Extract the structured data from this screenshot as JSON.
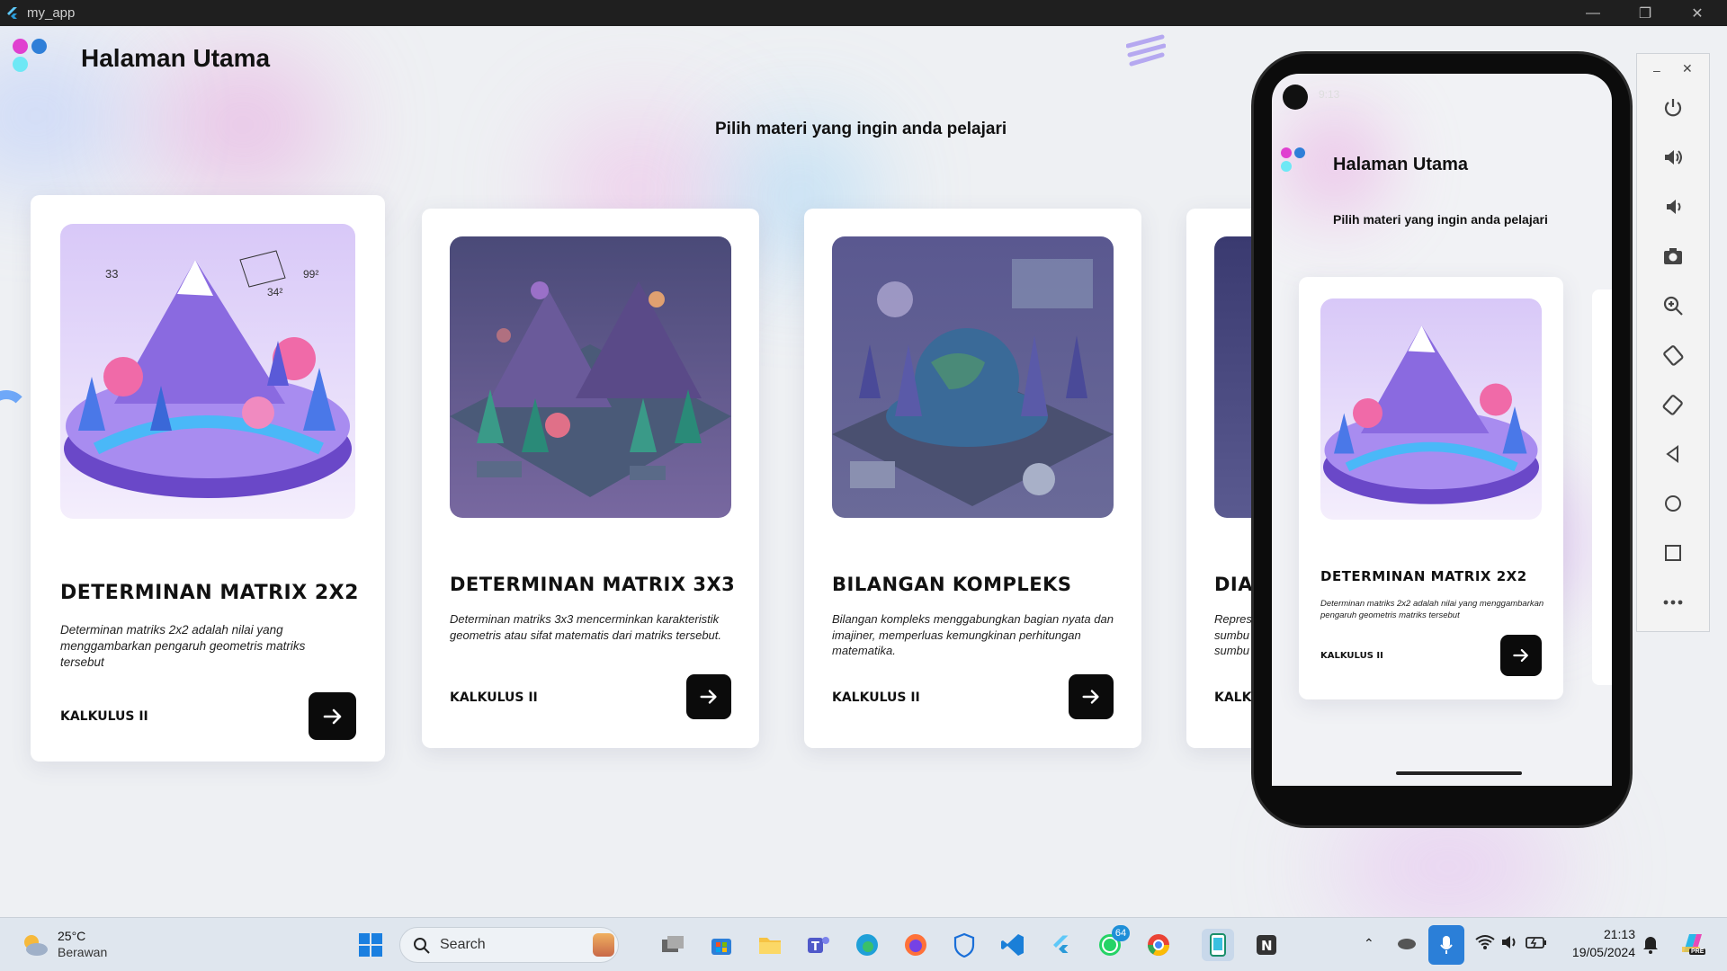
{
  "window": {
    "title": "my_app"
  },
  "page": {
    "title": "Halaman Utama",
    "subtitle": "Pilih materi yang ingin anda pelajari"
  },
  "cards": [
    {
      "title": "DETERMINAN MATRIX 2X2",
      "desc": "Determinan matriks 2x2 adalah nilai yang menggambarkan pengaruh geometris matriks tersebut",
      "tag": "KALKULUS II"
    },
    {
      "title": "DETERMINAN MATRIX 3X3",
      "desc": "Determinan matriks 3x3 mencerminkan karakteristik geometris atau sifat matematis dari matriks tersebut.",
      "tag": "KALKULUS II"
    },
    {
      "title": "BILANGAN KOMPLEKS",
      "desc": "Bilangan kompleks menggabungkan bagian nyata dan imajiner, memperluas kemungkinan perhitungan matematika.",
      "tag": "KALKULUS II"
    },
    {
      "title": "DIA",
      "desc_lines": [
        "Repres",
        "sumbu",
        "sumbu"
      ],
      "tag": "KALKU"
    }
  ],
  "phone": {
    "status_time": "9:13",
    "title": "Halaman Utama",
    "subtitle": "Pilih materi yang ingin anda pelajari",
    "card": {
      "title": "DETERMINAN MATRIX 2X2",
      "desc": "Determinan matriks 2x2 adalah nilai yang menggambarkan pengaruh geometris matriks tersebut",
      "tag": "KALKULUS II"
    }
  },
  "emulator_controls": [
    "power-icon",
    "volume-up-icon",
    "volume-down-icon",
    "camera-icon",
    "zoom-icon",
    "rotate-left-icon",
    "rotate-right-icon",
    "back-icon",
    "home-icon",
    "overview-icon",
    "more-icon"
  ],
  "taskbar": {
    "weather_temp": "25°C",
    "weather_desc": "Berawan",
    "search_placeholder": "Search",
    "whatsapp_badge": "64",
    "time": "21:13",
    "date": "19/05/2024",
    "copilot_badge": "PRE"
  },
  "colors": {
    "accent_pink": "#e040d0",
    "accent_blue": "#2f7fd8",
    "accent_cyan": "#6ee8f5",
    "card_button": "#0b0b0b"
  }
}
